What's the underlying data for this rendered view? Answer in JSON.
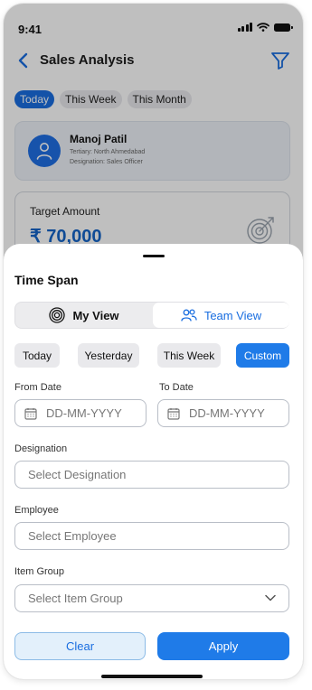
{
  "status_bar": {
    "time": "9:41"
  },
  "header": {
    "title": "Sales Analysis"
  },
  "period_chips": [
    {
      "label": "Today",
      "active": true
    },
    {
      "label": "This Week",
      "active": false
    },
    {
      "label": "This Month",
      "active": false
    }
  ],
  "profile": {
    "name": "Manoj Patil",
    "territory": "Tertiary: North Ahmedabad",
    "designation": "Designation: Sales Officer"
  },
  "target": {
    "label": "Target Amount",
    "value": "₹ 70,000"
  },
  "sheet": {
    "title": "Time Span",
    "view_toggle": {
      "my_view": "My View",
      "team_view": "Team View",
      "selected": "Team View"
    },
    "quick_ranges": [
      {
        "label": "Today",
        "selected": false
      },
      {
        "label": "Yesterday",
        "selected": false
      },
      {
        "label": "This Week",
        "selected": false
      },
      {
        "label": "Custom",
        "selected": true
      }
    ],
    "from_date": {
      "label": "From Date",
      "placeholder": "DD-MM-YYYY"
    },
    "to_date": {
      "label": "To Date",
      "placeholder": "DD-MM-YYYY"
    },
    "designation": {
      "label": "Designation",
      "placeholder": "Select Designation"
    },
    "employee": {
      "label": "Employee",
      "placeholder": "Select Employee"
    },
    "item_group": {
      "label": "Item Group",
      "placeholder": "Select Item Group"
    },
    "clear_label": "Clear",
    "apply_label": "Apply"
  },
  "colors": {
    "accent": "#1f7be8",
    "link": "#1a6ee0",
    "clear_bg": "#e3f0fb",
    "overlay": "rgba(0,0,0,0.25)"
  },
  "icons": [
    "back-chevron-icon",
    "filter-icon",
    "user-icon",
    "target-icon",
    "radar-icon",
    "team-icon",
    "calendar-icon",
    "chevron-down-icon"
  ]
}
